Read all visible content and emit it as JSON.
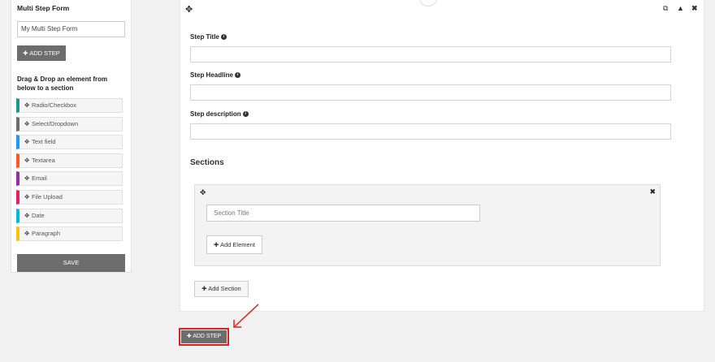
{
  "sidebar": {
    "title": "Multi Step Form",
    "form_name_value": "My Multi Step Form",
    "add_step_label": "✚ ADD STEP",
    "drag_drop_text": "Drag & Drop an element from below to a section",
    "elements": [
      {
        "label": "Radio/Checkbox",
        "color": "#1a9a8a"
      },
      {
        "label": "Select/Dropdown",
        "color": "#6d6d6d"
      },
      {
        "label": "Text field",
        "color": "#2196f3"
      },
      {
        "label": "Textarea",
        "color": "#ff5722"
      },
      {
        "label": "Email",
        "color": "#9c27b0"
      },
      {
        "label": "File Upload",
        "color": "#e91e63"
      },
      {
        "label": "Date",
        "color": "#00bcd4"
      },
      {
        "label": "Paragraph",
        "color": "#ffc107"
      }
    ],
    "save_label": "SAVE"
  },
  "step": {
    "step_title_label": "Step Title",
    "step_headline_label": "Step Headline",
    "step_description_label": "Step description",
    "sections_heading": "Sections",
    "section": {
      "title_placeholder": "Section Title",
      "add_element_label": "✚ Add Element"
    },
    "add_section_label": "✚ Add Section"
  },
  "footer": {
    "add_step_label": "✚ ADD STEP",
    "highlight_color": "#e02020"
  }
}
